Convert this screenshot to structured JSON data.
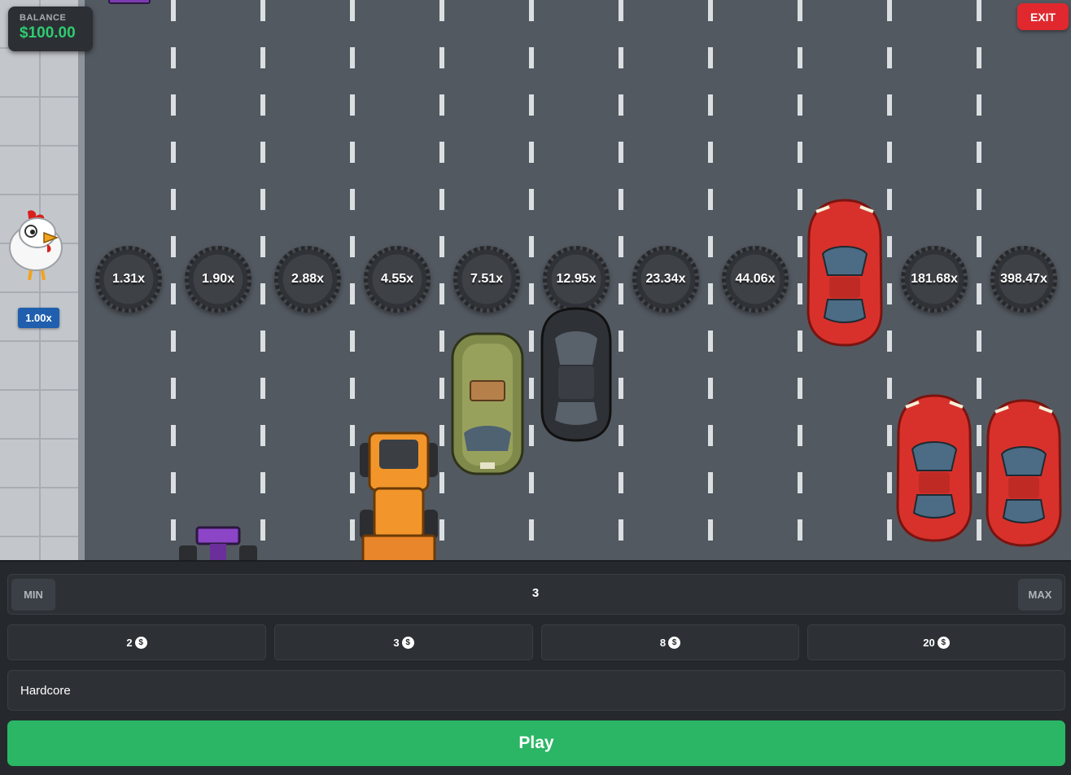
{
  "header": {
    "balance_label": "BALANCE",
    "balance_value": "$100.00",
    "exit_label": "EXIT"
  },
  "game": {
    "current_multiplier": "1.00x",
    "lane_multipliers": [
      "1.31x",
      "1.90x",
      "2.88x",
      "4.55x",
      "7.51x",
      "12.95x",
      "23.34x",
      "44.06x",
      "",
      "181.68x",
      "398.47x"
    ],
    "lane_blocked_by_car": 9,
    "colors": {
      "road": "#535961",
      "sidewalk": "#c3c7cc",
      "balance_green": "#2ecc71",
      "exit_red": "#e0282e",
      "play_green": "#2ab665",
      "multiplier_badge_blue": "#1f5fae"
    }
  },
  "controls": {
    "bet_min_label": "MIN",
    "bet_max_label": "MAX",
    "bet_value": "3",
    "chips": [
      {
        "amount": "2",
        "icon": "dollar-coin-icon",
        "symbol": "$"
      },
      {
        "amount": "3",
        "icon": "dollar-coin-icon",
        "symbol": "$"
      },
      {
        "amount": "8",
        "icon": "dollar-coin-icon",
        "symbol": "$"
      },
      {
        "amount": "20",
        "icon": "dollar-coin-icon",
        "symbol": "$"
      }
    ],
    "difficulty": "Hardcore",
    "play_label": "Play"
  }
}
